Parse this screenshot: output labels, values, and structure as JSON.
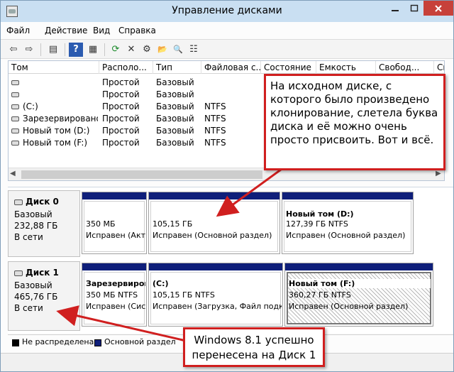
{
  "window": {
    "title": "Управление дисками"
  },
  "menu": [
    "Файл",
    "Действие",
    "Вид",
    "Справка"
  ],
  "toolbar": [
    {
      "name": "back-icon",
      "glyph": "⇦"
    },
    {
      "name": "forward-icon",
      "glyph": "⇨"
    },
    {
      "name": "console-tree-icon",
      "glyph": "▤"
    },
    {
      "name": "help-icon",
      "glyph": "?"
    },
    {
      "name": "properties-icon",
      "glyph": "▦"
    },
    {
      "name": "refresh-icon",
      "glyph": "⟳"
    },
    {
      "name": "delete-icon",
      "glyph": "✕"
    },
    {
      "name": "settings-icon",
      "glyph": "⚙"
    },
    {
      "name": "open-folder-icon",
      "glyph": "📂"
    },
    {
      "name": "search-icon",
      "glyph": "🔍"
    },
    {
      "name": "list-icon",
      "glyph": "☷"
    }
  ],
  "table": {
    "columns": [
      "Том",
      "Располо...",
      "Тип",
      "Файловая с...",
      "Состояние",
      "Емкость",
      "Свобод...",
      "Св"
    ],
    "rows": [
      [
        "",
        "Простой",
        "Базовый",
        "",
        "",
        "",
        "",
        ""
      ],
      [
        "",
        "Простой",
        "Базовый",
        "",
        "",
        "",
        "",
        ""
      ],
      [
        "(C:)",
        "Простой",
        "Базовый",
        "NTFS",
        "",
        "",
        "",
        ""
      ],
      [
        "Зарезервировано...",
        "Простой",
        "Базовый",
        "NTFS",
        "",
        "",
        "",
        ""
      ],
      [
        "Новый том (D:)",
        "Простой",
        "Базовый",
        "NTFS",
        "",
        "",
        "",
        ""
      ],
      [
        "Новый том (F:)",
        "Простой",
        "Базовый",
        "NTFS",
        "",
        "",
        "",
        ""
      ]
    ]
  },
  "disks": [
    {
      "name": "Диск 0",
      "type": "Базовый",
      "size": "232,88 ГБ",
      "status": "В сети",
      "partitions": [
        {
          "title": "",
          "size": "350 МБ",
          "status": "Исправен (Акт",
          "hatched": false
        },
        {
          "title": "",
          "size": "105,15 ГБ",
          "status": "Исправен (Основной раздел)",
          "hatched": false
        },
        {
          "title": "Новый том  (D:)",
          "size": "127,39 ГБ NTFS",
          "status": "Исправен (Основной раздел)",
          "hatched": false
        }
      ]
    },
    {
      "name": "Диск 1",
      "type": "Базовый",
      "size": "465,76 ГБ",
      "status": "В сети",
      "partitions": [
        {
          "title": "Зарезервиров",
          "size": "350 МБ NTFS",
          "status": "Исправен (Сис",
          "hatched": false
        },
        {
          "title": "(C:)",
          "size": "105,15 ГБ NTFS",
          "status": "Исправен (Загрузка, Файл подк",
          "hatched": false
        },
        {
          "title": "Новый том  (F:)",
          "size": "360,27 ГБ NTFS",
          "status": "Исправен (Основной раздел)",
          "hatched": true
        }
      ]
    }
  ],
  "legend": [
    {
      "label": "Не распределена",
      "color": "#000000"
    },
    {
      "label": "Основной раздел",
      "color": "#0f1f7a"
    }
  ],
  "annotations": {
    "note1": "На исходном диске, с которого было произведено клонирование, слетела буква диска и её можно очень просто присвоить. Вот и всё.",
    "note2": "Windows 8.1 успешно перенесена на Диск 1"
  },
  "colors": {
    "accent": "#d01f1f",
    "primary_partition": "#0f1f7a",
    "titlebar": "#c9dff2"
  }
}
